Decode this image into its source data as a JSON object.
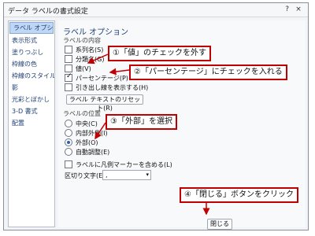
{
  "window": {
    "title": "データ ラベルの書式設定",
    "help_icon": "?",
    "close_icon": "×"
  },
  "sidebar": {
    "items": [
      {
        "label": "ラベル オプション"
      },
      {
        "label": "表示形式"
      },
      {
        "label": "塗りつぶし"
      },
      {
        "label": "枠線の色"
      },
      {
        "label": "枠線のスタイル"
      },
      {
        "label": "影"
      },
      {
        "label": "光彩とぼかし"
      },
      {
        "label": "3-D 書式"
      },
      {
        "label": "配置"
      }
    ]
  },
  "content": {
    "section_title": "ラベル オプション",
    "label_contains": "ラベルの内容",
    "series_name": "系列名(S)",
    "category_name": "分類名(G)",
    "value": "値(V)",
    "percentage": "パーセンテージ(P)",
    "leader_lines": "引き出し線を表示する(H)",
    "reset_text_button": "ラベル テキストのリセット(R)",
    "label_position": "ラベルの位置",
    "position_center": "中央(C)",
    "position_inside_end": "内部外側(I)",
    "position_outside_end": "外部(O)",
    "position_best_fit": "自動調整(E)",
    "legend_key": "ラベルに凡例マーカーを含める(L)",
    "separator_label": "区切り文字(E)",
    "separator_value": ",",
    "close_button": "閉じる"
  },
  "callouts": {
    "c1": "①「値」のチェックを外す",
    "c2": "②「パーセンテージ」にチェックを入れる",
    "c3": "③「外部」を選択",
    "c4": "④「閉じる」ボタンをクリック"
  },
  "colors": {
    "callout_border": "#c00000",
    "arrow": "#c00000"
  }
}
